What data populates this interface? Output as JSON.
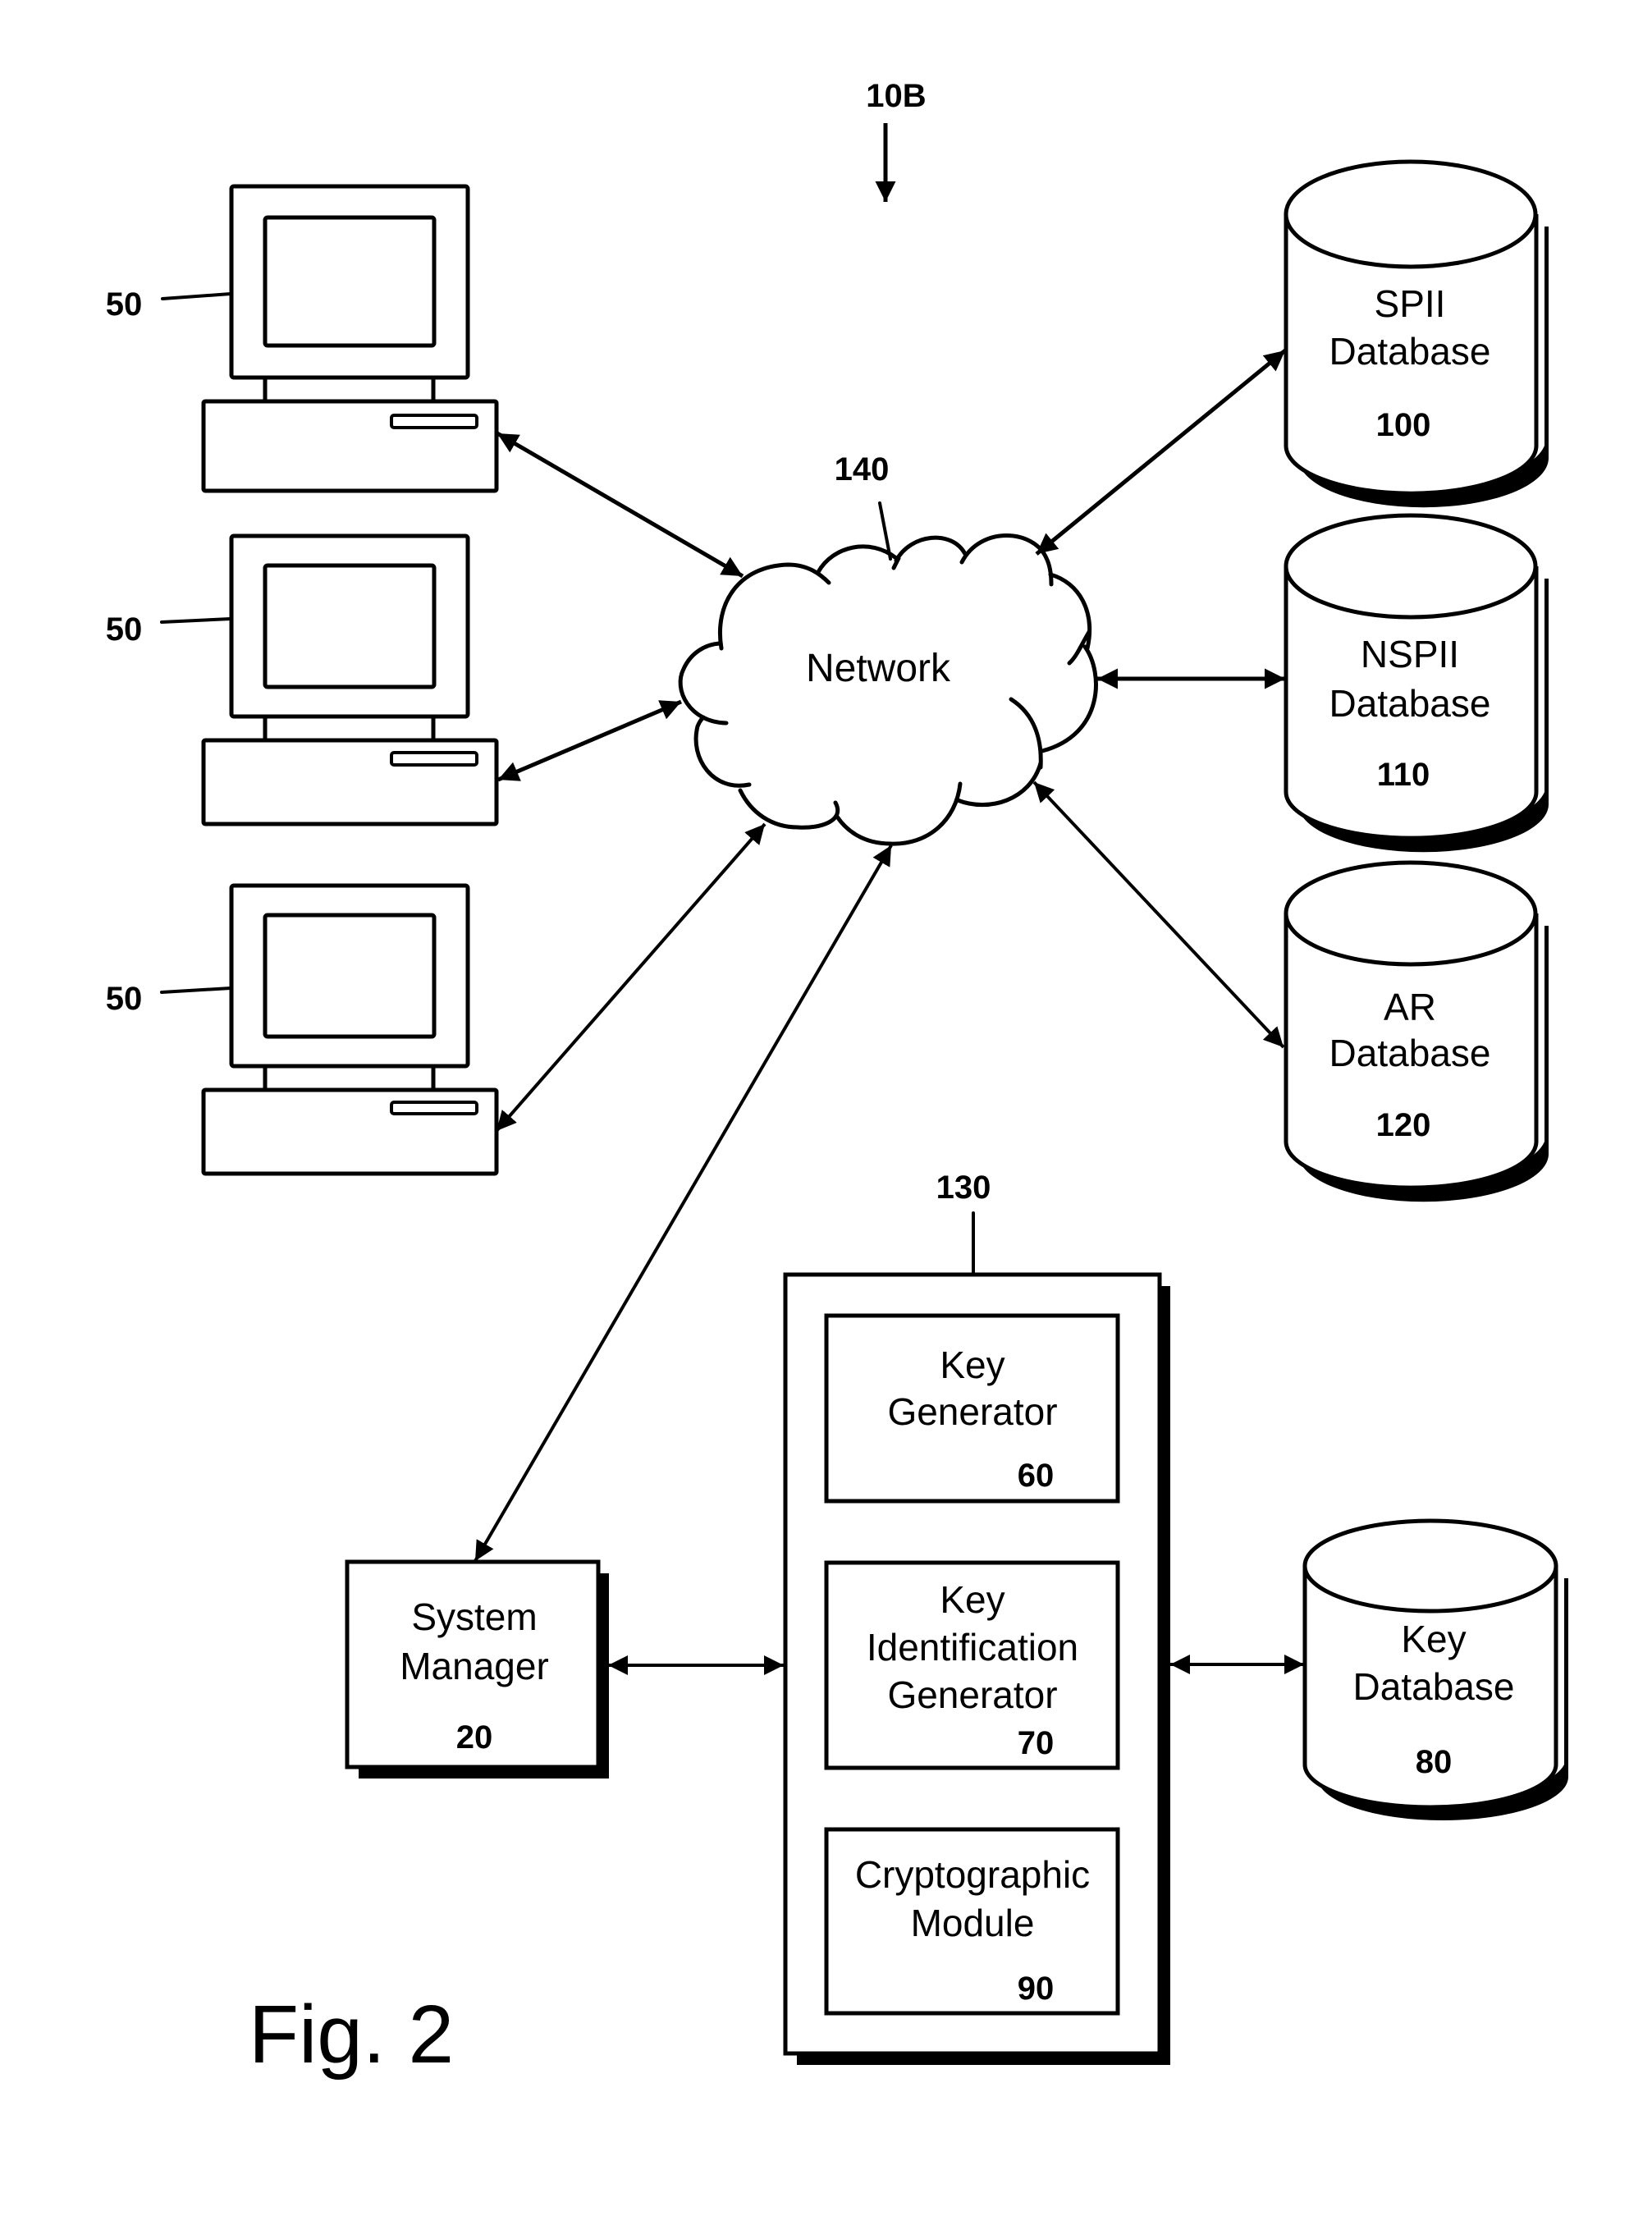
{
  "figure": {
    "title": "Fig. 2",
    "reference": "10B"
  },
  "computers": [
    {
      "ref": "50",
      "icon": "computer-icon"
    },
    {
      "ref": "50",
      "icon": "computer-icon"
    },
    {
      "ref": "50",
      "icon": "computer-icon"
    }
  ],
  "network": {
    "label": "Network",
    "ref": "140",
    "icon": "cloud-icon"
  },
  "databases": {
    "spii": {
      "line1": "SPII",
      "line2": "Database",
      "ref": "100",
      "icon": "database-cylinder-icon"
    },
    "nspii": {
      "line1": "NSPII",
      "line2": "Database",
      "ref": "110",
      "icon": "database-cylinder-icon"
    },
    "ar": {
      "line1": "AR",
      "line2": "Database",
      "ref": "120",
      "icon": "database-cylinder-icon"
    },
    "key": {
      "line1": "Key",
      "line2": "Database",
      "ref": "80",
      "icon": "database-cylinder-icon"
    }
  },
  "system_manager": {
    "line1": "System",
    "line2": "Manager",
    "ref": "20"
  },
  "module_container": {
    "ref": "130",
    "components": {
      "key_generator": {
        "line1": "Key",
        "line2": "Generator",
        "ref": "60"
      },
      "key_id_generator": {
        "line1": "Key",
        "line2": "Identification",
        "line3": "Generator",
        "ref": "70"
      },
      "crypto_module": {
        "line1": "Cryptographic",
        "line2": "Module",
        "ref": "90"
      }
    }
  },
  "connections": [
    {
      "from": "computer-1",
      "to": "network",
      "type": "bidirectional"
    },
    {
      "from": "computer-2",
      "to": "network",
      "type": "bidirectional"
    },
    {
      "from": "computer-3",
      "to": "network",
      "type": "bidirectional"
    },
    {
      "from": "network",
      "to": "spii-database",
      "type": "bidirectional"
    },
    {
      "from": "network",
      "to": "nspii-database",
      "type": "bidirectional"
    },
    {
      "from": "network",
      "to": "ar-database",
      "type": "bidirectional"
    },
    {
      "from": "network",
      "to": "system-manager",
      "type": "bidirectional"
    },
    {
      "from": "system-manager",
      "to": "module-container",
      "type": "bidirectional"
    },
    {
      "from": "module-container",
      "to": "key-database",
      "type": "bidirectional"
    }
  ]
}
